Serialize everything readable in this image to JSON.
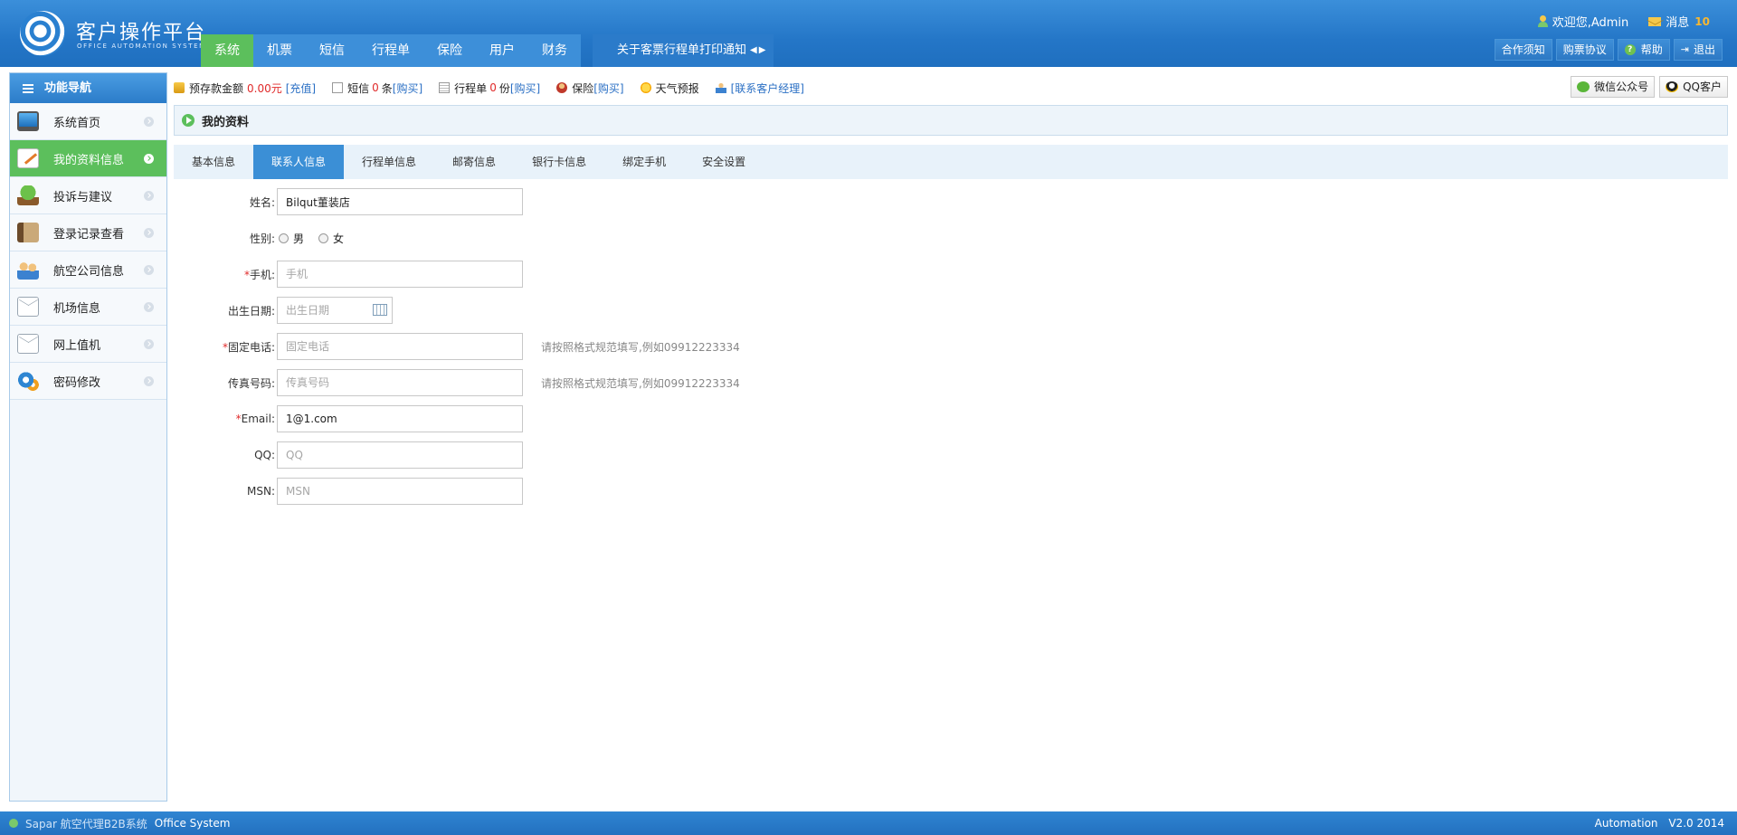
{
  "header": {
    "title": "客户操作平台",
    "subtitle": "OFFICE AUTOMATION SYSTEM",
    "nav": [
      "系统",
      "机票",
      "短信",
      "行程单",
      "保险",
      "用户",
      "财务"
    ],
    "notice": "关于客票行程单打印通知",
    "welcome": "欢迎您,Admin",
    "messages_label": "消息",
    "messages_count": "10",
    "buttons": {
      "coop": "合作须知",
      "purchase": "购票协议",
      "help": "帮助",
      "logout": "退出"
    }
  },
  "sidebar": {
    "title": "功能导航",
    "items": [
      {
        "label": "系统首页"
      },
      {
        "label": "我的资料信息"
      },
      {
        "label": "投诉与建议"
      },
      {
        "label": "登录记录查看"
      },
      {
        "label": "航空公司信息"
      },
      {
        "label": "机场信息"
      },
      {
        "label": "网上值机"
      },
      {
        "label": "密码修改"
      }
    ]
  },
  "infobar": {
    "deposit_label": "预存款金额",
    "deposit_value": "0.00元",
    "recharge": "[充值]",
    "sms_label": "短信",
    "sms_count": "0",
    "sms_unit": "条",
    "sms_buy": "[购买]",
    "itinerary_label": "行程单",
    "itinerary_count": "0",
    "itinerary_unit": "份",
    "itinerary_buy": "[购买]",
    "insurance_label": "保险",
    "insurance_buy": "[购买]",
    "weather": "天气预报",
    "manager": "[联系客户经理]",
    "wechat": "微信公众号",
    "qq": "QQ客户"
  },
  "page": {
    "title": "我的资料",
    "tabs": [
      "基本信息",
      "联系人信息",
      "行程单信息",
      "邮寄信息",
      "银行卡信息",
      "绑定手机",
      "安全设置"
    ]
  },
  "form": {
    "name_label": "姓名:",
    "name_value": "Bilqut董装店",
    "gender_label": "性别:",
    "gender_male": "男",
    "gender_female": "女",
    "mobile_label": "手机:",
    "mobile_placeholder": "手机",
    "birth_label": "出生日期:",
    "birth_placeholder": "出生日期",
    "phone_label": "固定电话:",
    "phone_placeholder": "固定电话",
    "phone_hint": "请按照格式规范填写,例如09912223334",
    "fax_label": "传真号码:",
    "fax_placeholder": "传真号码",
    "fax_hint": "请按照格式规范填写,例如09912223334",
    "email_label": "Email:",
    "email_value": "1@1.com",
    "qq_label": "QQ:",
    "qq_placeholder": "QQ",
    "msn_label": "MSN:",
    "msn_placeholder": "MSN"
  },
  "footer": {
    "left": "Sapar 航空代理B2B系统",
    "system": "Office System",
    "right": "Automation",
    "version": "V2.0 2014"
  }
}
